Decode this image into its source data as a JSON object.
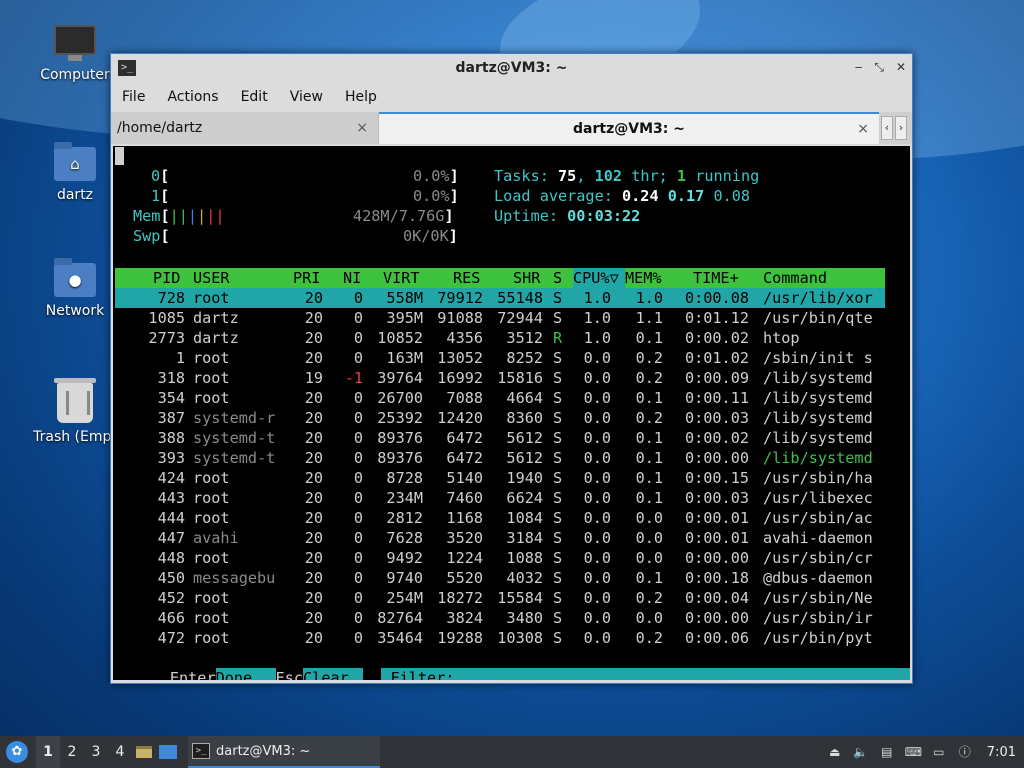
{
  "desktop": {
    "icons": [
      {
        "label": "Computer"
      },
      {
        "label": "dartz"
      },
      {
        "label": "Network"
      },
      {
        "label": "Trash (Empt"
      }
    ]
  },
  "window": {
    "title": "dartz@VM3: ~",
    "menu": [
      "File",
      "Actions",
      "Edit",
      "View",
      "Help"
    ],
    "tabs": [
      {
        "label": "/home/dartz",
        "close": "×"
      },
      {
        "label": "dartz@VM3: ~",
        "close": "×"
      }
    ],
    "tab_nav": [
      "‹",
      "›"
    ],
    "controls": [
      "‒",
      "⤡",
      "✕"
    ]
  },
  "htop": {
    "cpu0": {
      "label": "0",
      "pct": "0.0%"
    },
    "cpu1": {
      "label": "1",
      "pct": "0.0%"
    },
    "mem": {
      "label": "Mem",
      "value": "428M/7.76G"
    },
    "swp": {
      "label": "Swp",
      "value": "0K/0K"
    },
    "tasks_label": "Tasks: ",
    "tasks": "75",
    "threads": "102",
    "thr_label": " thr; ",
    "running": "1",
    "running_label": " running",
    "load_label": "Load average: ",
    "load1": "0.24",
    "load5": "0.17",
    "load15": "0.08",
    "uptime_label": "Uptime: ",
    "uptime": "00:03:22",
    "columns": [
      "PID",
      "USER",
      "PRI",
      "NI",
      "VIRT",
      "RES",
      "SHR",
      "S",
      "CPU%▽",
      "MEM%",
      "TIME+",
      "Command"
    ],
    "rows": [
      {
        "pid": "728",
        "user": "root",
        "pri": "20",
        "ni": "0",
        "virt": "558M",
        "res": "79912",
        "shr": "55148",
        "s": "S",
        "cpu": "1.0",
        "mem": "1.0",
        "time": "0:00.08",
        "cmd": "/usr/lib/xor"
      },
      {
        "pid": "1085",
        "user": "dartz",
        "pri": "20",
        "ni": "0",
        "virt": "395M",
        "res": "91088",
        "shr": "72944",
        "s": "S",
        "cpu": "1.0",
        "mem": "1.1",
        "time": "0:01.12",
        "cmd": "/usr/bin/qte"
      },
      {
        "pid": "2773",
        "user": "dartz",
        "pri": "20",
        "ni": "0",
        "virt": "10852",
        "res": "4356",
        "shr": "3512",
        "s": "R",
        "cpu": "1.0",
        "mem": "0.1",
        "time": "0:00.02",
        "cmd": "htop"
      },
      {
        "pid": "1",
        "user": "root",
        "pri": "20",
        "ni": "0",
        "virt": "163M",
        "res": "13052",
        "shr": "8252",
        "s": "S",
        "cpu": "0.0",
        "mem": "0.2",
        "time": "0:01.02",
        "cmd": "/sbin/init s"
      },
      {
        "pid": "318",
        "user": "root",
        "pri": "19",
        "ni": "-1",
        "virt": "39764",
        "res": "16992",
        "shr": "15816",
        "s": "S",
        "cpu": "0.0",
        "mem": "0.2",
        "time": "0:00.09",
        "cmd": "/lib/systemd"
      },
      {
        "pid": "354",
        "user": "root",
        "pri": "20",
        "ni": "0",
        "virt": "26700",
        "res": "7088",
        "shr": "4664",
        "s": "S",
        "cpu": "0.0",
        "mem": "0.1",
        "time": "0:00.11",
        "cmd": "/lib/systemd"
      },
      {
        "pid": "387",
        "user": "systemd-r",
        "pri": "20",
        "ni": "0",
        "virt": "25392",
        "res": "12420",
        "shr": "8360",
        "s": "S",
        "cpu": "0.0",
        "mem": "0.2",
        "time": "0:00.03",
        "cmd": "/lib/systemd"
      },
      {
        "pid": "388",
        "user": "systemd-t",
        "pri": "20",
        "ni": "0",
        "virt": "89376",
        "res": "6472",
        "shr": "5612",
        "s": "S",
        "cpu": "0.0",
        "mem": "0.1",
        "time": "0:00.02",
        "cmd": "/lib/systemd"
      },
      {
        "pid": "393",
        "user": "systemd-t",
        "pri": "20",
        "ni": "0",
        "virt": "89376",
        "res": "6472",
        "shr": "5612",
        "s": "S",
        "cpu": "0.0",
        "mem": "0.1",
        "time": "0:00.00",
        "cmd": "/lib/systemd"
      },
      {
        "pid": "424",
        "user": "root",
        "pri": "20",
        "ni": "0",
        "virt": "8728",
        "res": "5140",
        "shr": "1940",
        "s": "S",
        "cpu": "0.0",
        "mem": "0.1",
        "time": "0:00.15",
        "cmd": "/usr/sbin/ha"
      },
      {
        "pid": "443",
        "user": "root",
        "pri": "20",
        "ni": "0",
        "virt": "234M",
        "res": "7460",
        "shr": "6624",
        "s": "S",
        "cpu": "0.0",
        "mem": "0.1",
        "time": "0:00.03",
        "cmd": "/usr/libexec"
      },
      {
        "pid": "444",
        "user": "root",
        "pri": "20",
        "ni": "0",
        "virt": "2812",
        "res": "1168",
        "shr": "1084",
        "s": "S",
        "cpu": "0.0",
        "mem": "0.0",
        "time": "0:00.01",
        "cmd": "/usr/sbin/ac"
      },
      {
        "pid": "447",
        "user": "avahi",
        "pri": "20",
        "ni": "0",
        "virt": "7628",
        "res": "3520",
        "shr": "3184",
        "s": "S",
        "cpu": "0.0",
        "mem": "0.0",
        "time": "0:00.01",
        "cmd": "avahi-daemon"
      },
      {
        "pid": "448",
        "user": "root",
        "pri": "20",
        "ni": "0",
        "virt": "9492",
        "res": "1224",
        "shr": "1088",
        "s": "S",
        "cpu": "0.0",
        "mem": "0.0",
        "time": "0:00.00",
        "cmd": "/usr/sbin/cr"
      },
      {
        "pid": "450",
        "user": "messagebu",
        "pri": "20",
        "ni": "0",
        "virt": "9740",
        "res": "5520",
        "shr": "4032",
        "s": "S",
        "cpu": "0.0",
        "mem": "0.1",
        "time": "0:00.18",
        "cmd": "@dbus-daemon"
      },
      {
        "pid": "452",
        "user": "root",
        "pri": "20",
        "ni": "0",
        "virt": "254M",
        "res": "18272",
        "shr": "15584",
        "s": "S",
        "cpu": "0.0",
        "mem": "0.2",
        "time": "0:00.04",
        "cmd": "/usr/sbin/Ne"
      },
      {
        "pid": "466",
        "user": "root",
        "pri": "20",
        "ni": "0",
        "virt": "82764",
        "res": "3824",
        "shr": "3480",
        "s": "S",
        "cpu": "0.0",
        "mem": "0.0",
        "time": "0:00.00",
        "cmd": "/usr/sbin/ir"
      },
      {
        "pid": "472",
        "user": "root",
        "pri": "20",
        "ni": "0",
        "virt": "35464",
        "res": "19288",
        "shr": "10308",
        "s": "S",
        "cpu": "0.0",
        "mem": "0.2",
        "time": "0:00.06",
        "cmd": "/usr/bin/pyt"
      }
    ],
    "footer": {
      "enter_key": "Enter",
      "enter_action": "Done",
      "esc_key": "Esc",
      "esc_action": "Clear",
      "filter_label": " Filter: "
    }
  },
  "taskbar": {
    "workspaces": [
      "1",
      "2",
      "3",
      "4"
    ],
    "task_label": "dartz@VM3: ~",
    "clock": "7:01"
  },
  "colors": {
    "header_bg": "#3cc23c",
    "selected_bg": "#20a6a6",
    "accent": "#3f8ad6"
  }
}
